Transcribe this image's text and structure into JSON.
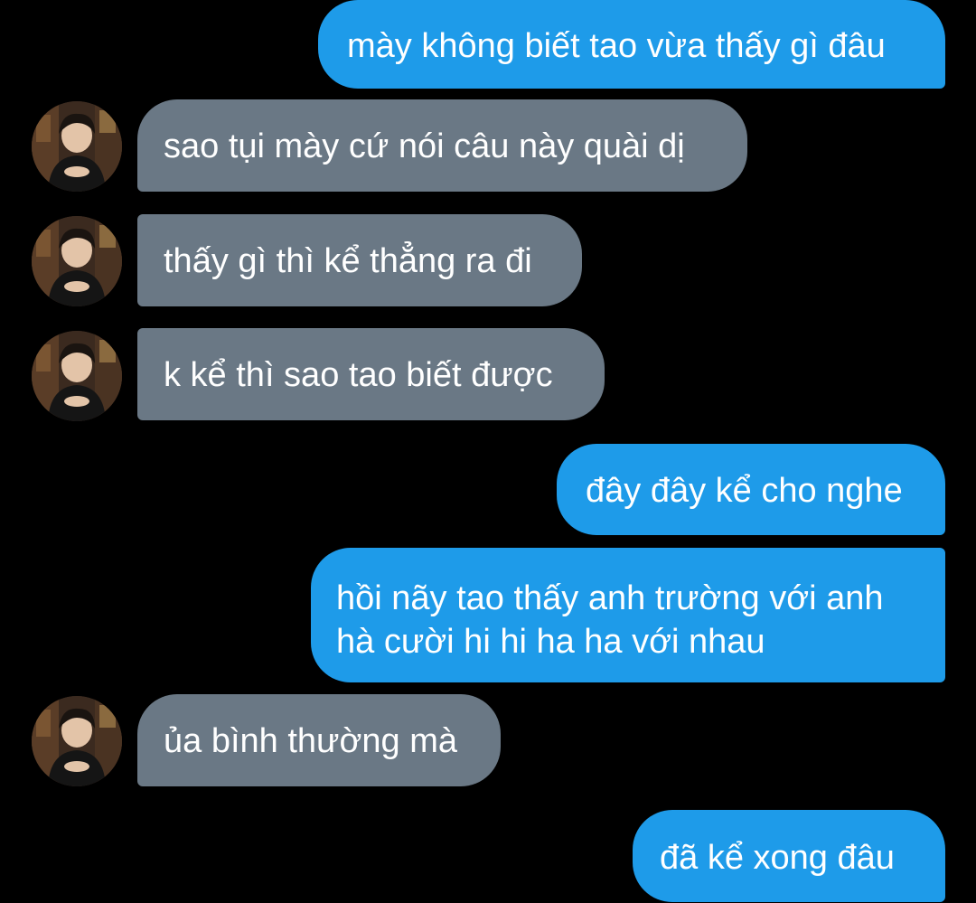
{
  "conversation": {
    "messages": [
      {
        "side": "sent",
        "text": "mày không biết tao vừa thấy gì đâu"
      },
      {
        "side": "received",
        "text": "sao tụi mày cứ nói câu này quài dị"
      },
      {
        "side": "received",
        "text": "thấy gì thì kể thẳng ra đi"
      },
      {
        "side": "received",
        "text": "k kể thì sao tao biết được"
      },
      {
        "side": "sent",
        "text": "đây đây kể cho nghe"
      },
      {
        "side": "sent",
        "lines": [
          "hồi nãy tao thấy anh trường với anh",
          "hà cười hi hi ha ha với nhau"
        ]
      },
      {
        "side": "received",
        "text": "ủa bình thường mà"
      },
      {
        "side": "sent",
        "text": "đã kể xong đâu"
      }
    ]
  },
  "colors": {
    "background": "#000000",
    "sent_bubble": "#1e9be9",
    "received_bubble": "#6a7885",
    "text": "#ffffff"
  },
  "avatar_icon": "contact-avatar-photo"
}
